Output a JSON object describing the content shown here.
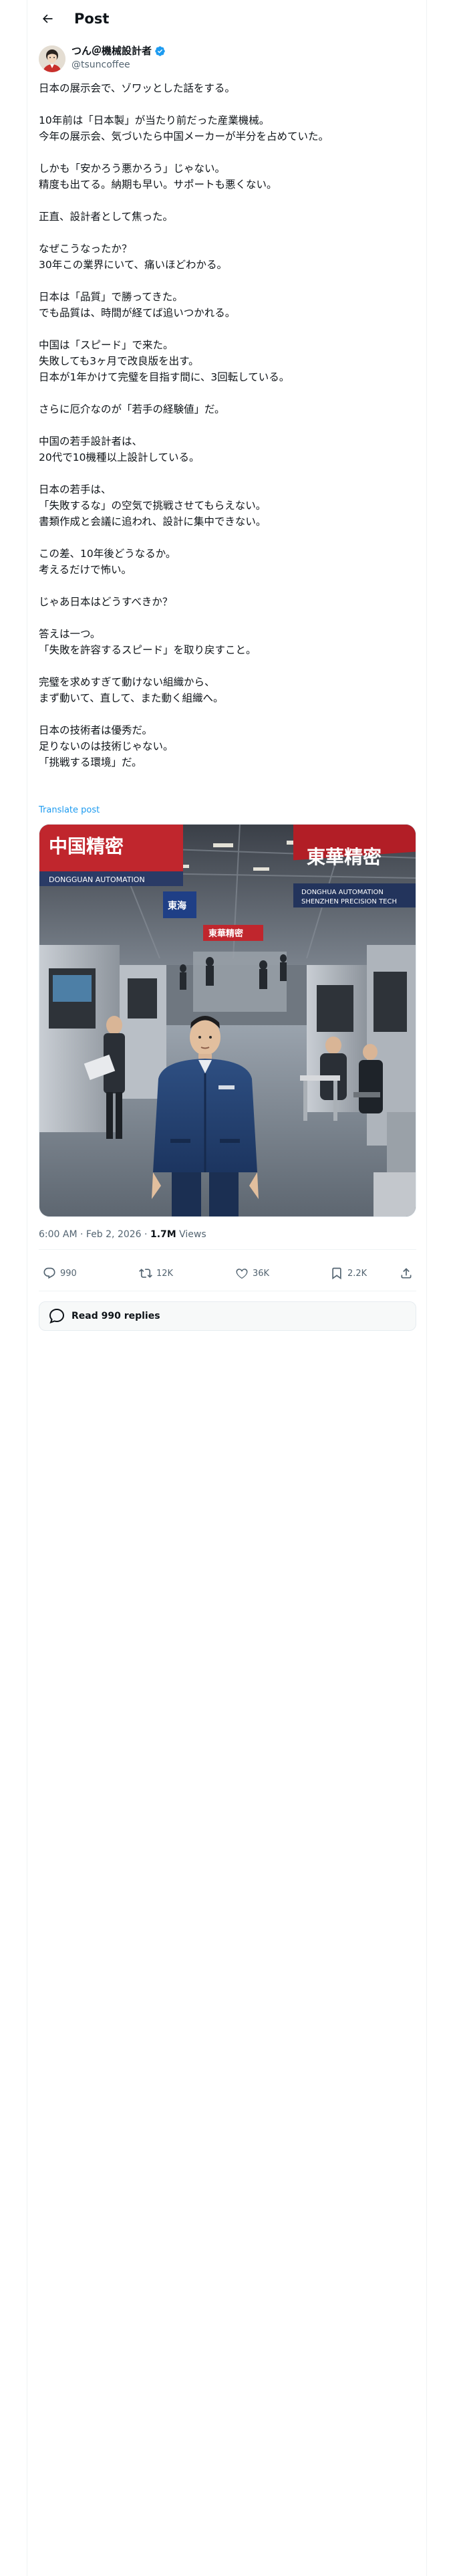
{
  "header": {
    "title": "Post"
  },
  "author": {
    "name": "つん＠機械設計者",
    "handle": "@tsuncoffee"
  },
  "post": {
    "paragraphs": [
      [
        "日本の展示会で、ゾワッとした話をする。"
      ],
      [
        "10年前は「日本製」が当たり前だった産業機械。",
        "今年の展示会、気づいたら中国メーカーが半分を占めていた。"
      ],
      [
        "しかも「安かろう悪かろう」じゃない。",
        "精度も出てる。納期も早い。サポートも悪くない。"
      ],
      [
        "正直、設計者として焦った。"
      ],
      [
        "なぜこうなったか？",
        "30年この業界にいて、痛いほどわかる。"
      ],
      [
        "日本は「品質」で勝ってきた。",
        "でも品質は、時間が経てば追いつかれる。"
      ],
      [
        "中国は「スピード」で来た。",
        "失敗しても3ヶ月で改良版を出す。",
        "日本が1年かけて完璧を目指す間に、3回転している。"
      ],
      [
        "さらに厄介なのが「若手の経験値」だ。"
      ],
      [
        "中国の若手設計者は、",
        "20代で10機種以上設計している。"
      ],
      [
        "日本の若手は、",
        "「失敗するな」の空気で挑戦させてもらえない。",
        "書類作成と会議に追われ、設計に集中できない。"
      ],
      [
        "この差、10年後どうなるか。",
        "考えるだけで怖い。"
      ],
      [
        "じゃあ日本はどうすべきか？"
      ],
      [
        "答えは一つ。",
        "「失敗を許容するスピード」を取り戻すこと。"
      ],
      [
        "完璧を求めすぎて動けない組織から、",
        "まず動いて、直して、また動く組織へ。"
      ],
      [
        "日本の技術者は優秀だ。",
        "足りないのは技術じゃない。",
        "「挑戦する環境」だ。"
      ]
    ],
    "translate_label": "Translate post",
    "time": "6:00 AM",
    "date": "Feb 2, 2026",
    "views_count": "1.7M",
    "views_label": "Views"
  },
  "photo": {
    "banner_left_top": "中国精密",
    "banner_left_sub": "DONGGUAN AUTOMATION",
    "banner_right_top": "東華精密",
    "banner_right_sub": "DONGHUA AUTOMATION",
    "banner_right_sub2": "SHENZHEN PRECISION TECH",
    "banner_center": "東華精密",
    "banner_blue": "東海"
  },
  "actions": {
    "replies": "990",
    "reposts": "12K",
    "likes": "36K",
    "bookmarks": "2.2K"
  },
  "read_replies_label": "Read 990 replies",
  "colors": {
    "accent": "#1d9bf0",
    "muted": "#536471",
    "text": "#0f1419"
  }
}
